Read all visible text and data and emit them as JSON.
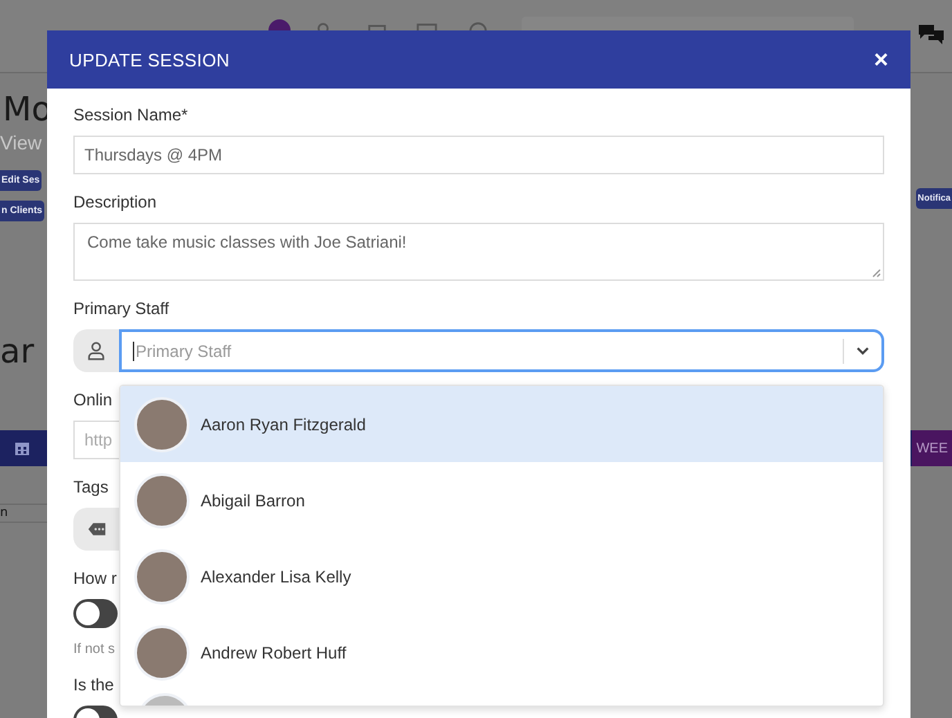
{
  "background": {
    "title": "Mo",
    "subtitle": "View",
    "left_buttons": [
      {
        "label": "Edit Ses"
      },
      {
        "label": "n Clients"
      }
    ],
    "right_button": "Notifica",
    "calendar_heading": "ar",
    "view_button": "WEE",
    "row_text": "n"
  },
  "modal": {
    "title": "UPDATE SESSION",
    "close": "×",
    "fields": [
      {
        "kind": "text",
        "label": "Session Name*",
        "value": "Thursdays @ 4PM"
      },
      {
        "kind": "textarea",
        "label": "Description",
        "value": "Come take music classes with Joe Satriani!"
      },
      {
        "kind": "select",
        "label": "Primary Staff",
        "placeholder": "Primary Staff",
        "expanded": true
      },
      {
        "kind": "text",
        "label": "Onlin",
        "placeholder": "http"
      },
      {
        "kind": "tags",
        "label": "Tags"
      },
      {
        "kind": "toggle",
        "label": "How r",
        "on": false,
        "hint": "If not s"
      },
      {
        "kind": "toggle",
        "label": "Is the",
        "on": false
      }
    ],
    "options": [
      {
        "name": "Aaron Ryan Fitzgerald",
        "selected": true
      },
      {
        "name": "Abigail Barron",
        "selected": false
      },
      {
        "name": "Alexander Lisa Kelly",
        "selected": false
      },
      {
        "name": "Andrew Robert Huff",
        "selected": false
      }
    ]
  }
}
